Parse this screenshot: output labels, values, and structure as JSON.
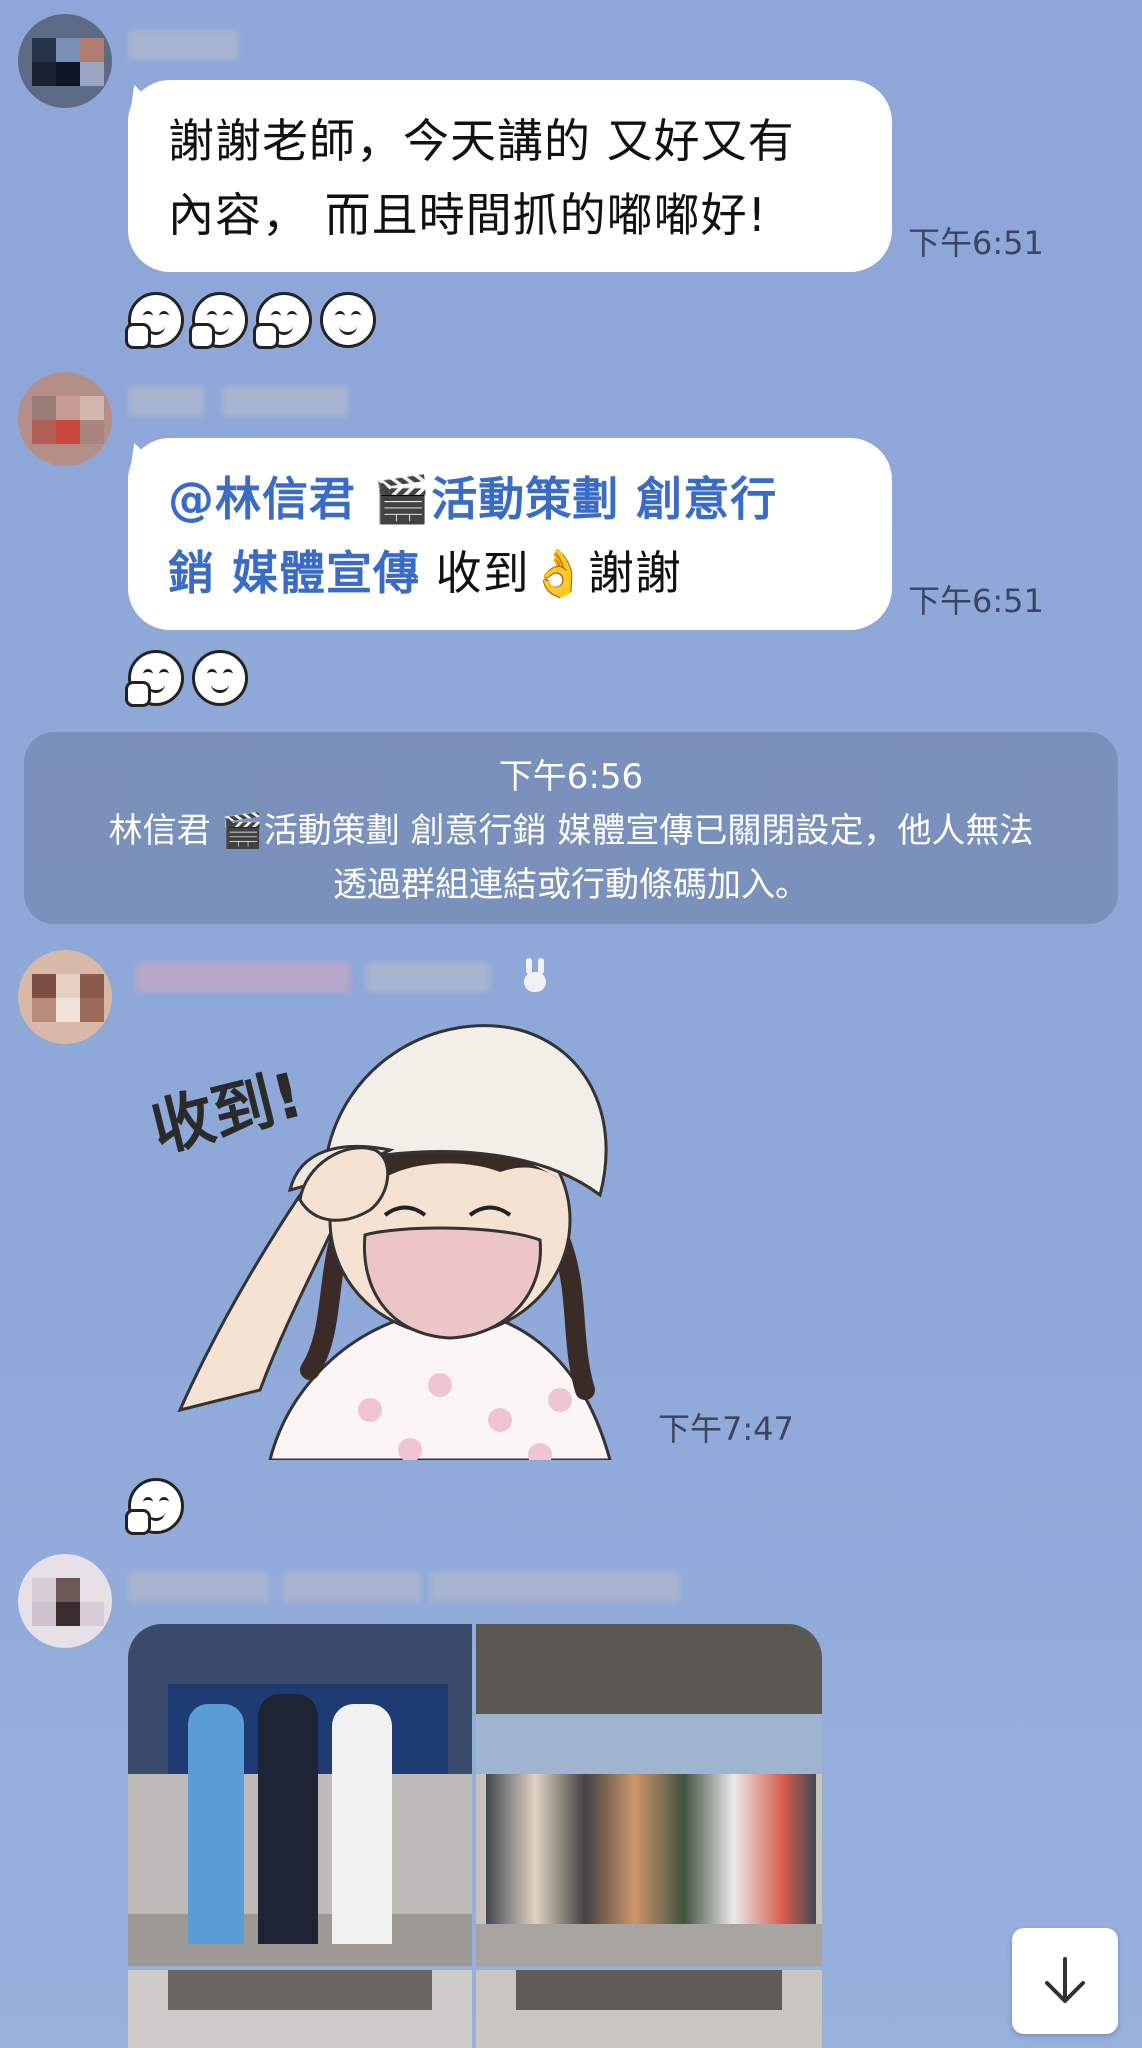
{
  "messages": [
    {
      "text": "謝謝老師，今天講的 又好又有內容， 而且時間抓的嘟嘟好!",
      "line1": "謝謝老師，今天講的 又好又有",
      "line2": "內容， 而且時間抓的嘟嘟好!",
      "time": "下午6:51"
    },
    {
      "mention_line1": "@林信君 🎬活動策劃 創意行",
      "mention_line2": "銷 媒體宣傳",
      "after": " 收到👌謝謝",
      "time": "下午6:51"
    }
  ],
  "system_message": {
    "time": "下午6:56",
    "line1": "林信君 🎬活動策劃 創意行銷 媒體宣傳已關閉設定，他人無法",
    "line2": "透過群組連結或行動條碼加入。"
  },
  "sticker": {
    "text": "收到!",
    "time": "下午7:47",
    "icon": "saluting-girl-sticker"
  },
  "scroll_button": {
    "icon": "arrow-down-icon"
  },
  "colors": {
    "background": "#8ea6d6",
    "bubble": "#ffffff",
    "mention": "#3a6bc5",
    "system_bg": "#6e82aa"
  }
}
